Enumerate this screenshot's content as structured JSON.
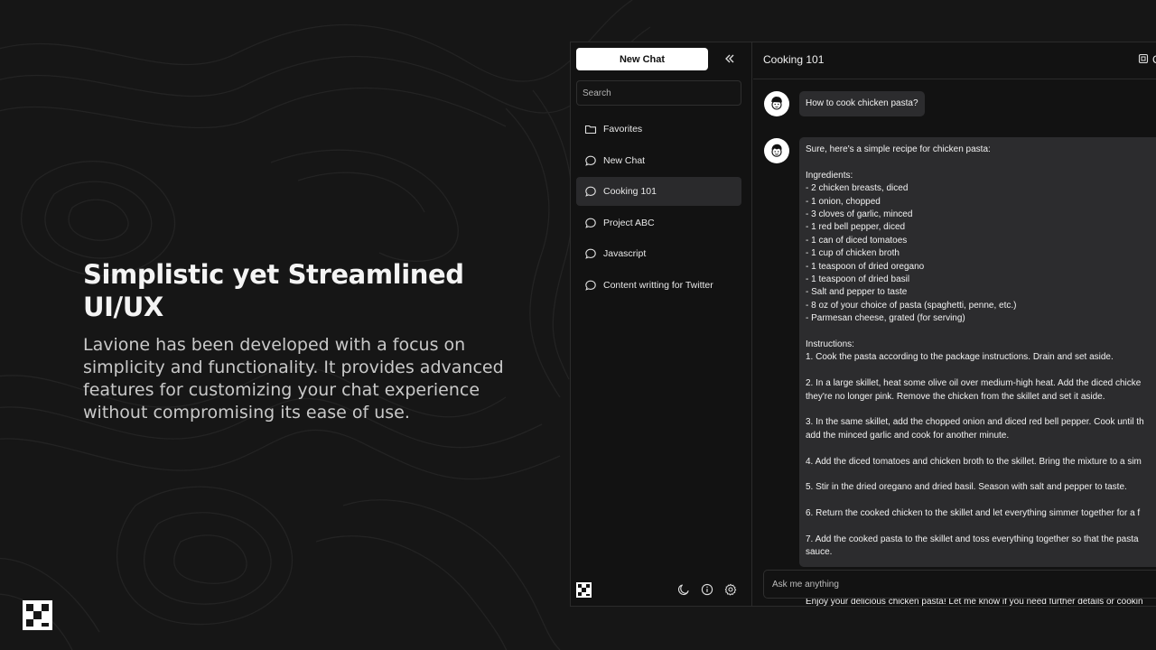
{
  "hero": {
    "title": "Simplistic yet Streamlined UI/UX",
    "description": "Lavione has been developed with a focus on simplicity and functionality. It provides advanced features for customizing your chat experience without compromising its ease of use."
  },
  "sidebar": {
    "new_chat_label": "New Chat",
    "search_placeholder": "Search",
    "items": [
      {
        "label": "Favorites",
        "icon": "folder-icon"
      },
      {
        "label": "New Chat",
        "icon": "chat-bubble-icon"
      },
      {
        "label": "Cooking 101",
        "icon": "chat-bubble-icon",
        "active": true
      },
      {
        "label": "Project ABC",
        "icon": "chat-bubble-icon"
      },
      {
        "label": "Javascript",
        "icon": "chat-bubble-icon"
      },
      {
        "label": "Content writting for Twitter",
        "icon": "chat-bubble-icon"
      }
    ]
  },
  "header": {
    "title": "Cooking 101",
    "action_text": "C"
  },
  "messages": {
    "user": "How to cook chicken pasta?",
    "bot_lines": [
      "Sure, here's a simple recipe for chicken pasta:",
      "",
      "Ingredients:",
      "- 2 chicken breasts, diced",
      "- 1 onion, chopped",
      "- 3 cloves of garlic, minced",
      "- 1 red bell pepper, diced",
      "- 1 can of diced tomatoes",
      "- 1 cup of chicken broth",
      "- 1 teaspoon of dried oregano",
      "- 1 teaspoon of dried basil",
      "- Salt and pepper to taste",
      "- 8 oz of your choice of pasta (spaghetti, penne, etc.)",
      "- Parmesan cheese, grated (for serving)",
      "",
      "Instructions:",
      "1. Cook the pasta according to the package instructions. Drain and set aside.",
      "",
      "2. In a large skillet, heat some olive oil over medium-high heat. Add the diced chicke",
      "they're no longer pink. Remove the chicken from the skillet and set it aside.",
      "",
      "3. In the same skillet, add the chopped onion and diced red bell pepper. Cook until th",
      "add the minced garlic and cook for another minute.",
      "",
      "4. Add the diced tomatoes and chicken broth to the skillet. Bring the mixture to a sim",
      "",
      "5. Stir in the dried oregano and dried basil. Season with salt and pepper to taste.",
      "",
      "6. Return the cooked chicken to the skillet and let everything simmer together for a f",
      "",
      "7. Add the cooked pasta to the skillet and toss everything together so that the pasta",
      "sauce."
    ],
    "bot_last_line": "Enjoy your delicious chicken pasta! Let me know if you need further details or cookin"
  },
  "composer": {
    "placeholder": "Ask me anything"
  },
  "colors": {
    "background": "#161616",
    "panel": "#121212",
    "bubble": "#2c2c2e",
    "active_item": "#2a2a2c",
    "accent": "#ffffff"
  }
}
